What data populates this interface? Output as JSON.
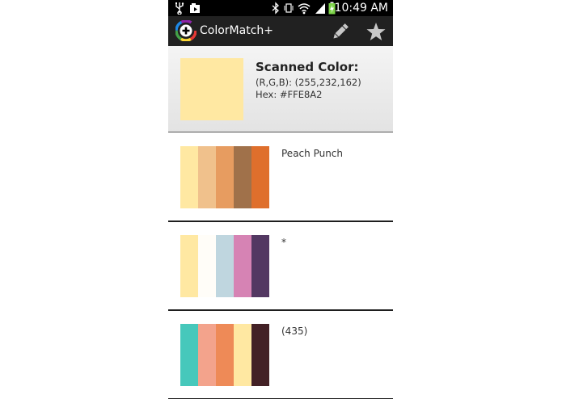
{
  "status_bar": {
    "time": "10:49 AM",
    "icons": [
      "usb-icon",
      "photo-notification-icon",
      "bluetooth-icon",
      "vibrate-icon",
      "wifi-icon",
      "signal-icon",
      "battery-charging-icon"
    ]
  },
  "action_bar": {
    "app_title": "ColorMatch+",
    "logo_icon": "colorwheel-plus-icon",
    "actions": [
      "pencil-icon",
      "star-icon"
    ]
  },
  "scanned": {
    "label": "Scanned Color:",
    "rgb": "(R,G,B): (255,232,162)",
    "hex": "Hex: #FFE8A2",
    "color": "#FFE8A2"
  },
  "palettes": [
    {
      "name": "Peach Punch",
      "colors": [
        "#FFE8A2",
        "#F0C18C",
        "#E79C60",
        "#A0714A",
        "#DF6F2C"
      ]
    },
    {
      "name": "*",
      "colors": [
        "#FFE8A2",
        "#FFFDF8",
        "#BFD6DF",
        "#D683B4",
        "#533862"
      ]
    },
    {
      "name": "(435)",
      "colors": [
        "#46C8BB",
        "#F3A38C",
        "#EE8A57",
        "#FFE8A2",
        "#432126"
      ]
    }
  ]
}
